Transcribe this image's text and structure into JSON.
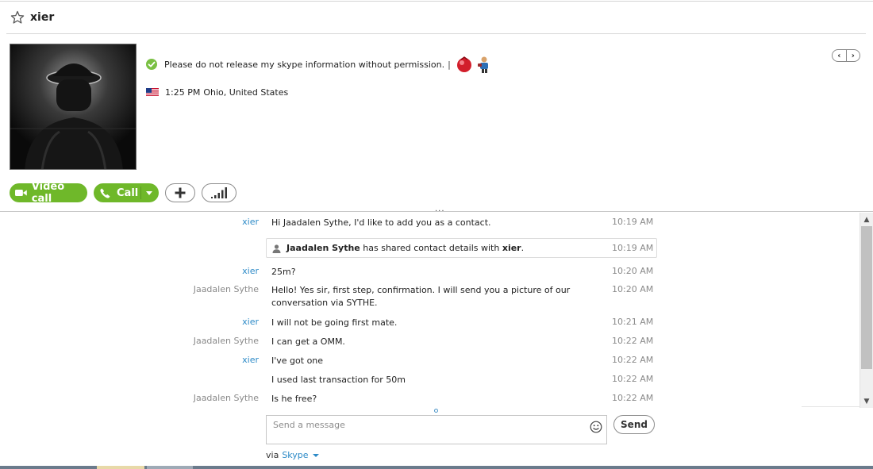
{
  "header": {
    "contact_name": "xier"
  },
  "profile": {
    "mood": "Please do not release my skype information without permission.",
    "mood_separator": "|",
    "local_time": "1:25 PM",
    "location": "Ohio, United States"
  },
  "actions": {
    "video_call_label": "Video call",
    "call_label": "Call"
  },
  "messages": [
    {
      "sender": "xier",
      "text": "Hi Jaadalen Sythe, I'd like to add you as a contact.",
      "time": "10:19 AM"
    },
    {
      "sender": "xier",
      "text": "25m?",
      "time": "10:20 AM"
    },
    {
      "sender": "Jaadalen Sythe",
      "text": "Hello! Yes sir, first step, confirmation. I will send you a picture of our conversation via SYTHE.",
      "time": "10:20 AM"
    },
    {
      "sender": "xier",
      "text": "I will not be going first mate.",
      "time": "10:21 AM"
    },
    {
      "sender": "Jaadalen Sythe",
      "text": "I can get a OMM.",
      "time": "10:22 AM"
    },
    {
      "sender": "xier",
      "text": "I've got one",
      "time": "10:22 AM"
    },
    {
      "sender": "",
      "text": "I used last transaction for 50m",
      "time": "10:22 AM"
    },
    {
      "sender": "Jaadalen Sythe",
      "text": "Is he free?",
      "time": "10:22 AM"
    }
  ],
  "system_message": {
    "from": "Jaadalen Sythe",
    "middle": "has shared contact details with",
    "to": "xier",
    "end": ".",
    "time": "10:19 AM"
  },
  "compose": {
    "placeholder": "Send a message",
    "send_label": "Send",
    "via_label": "via",
    "via_service": "Skype"
  },
  "colors": {
    "accent_green": "#6fb82a",
    "link_blue": "#2c8ac7",
    "muted_gray": "#8a8a8a"
  }
}
